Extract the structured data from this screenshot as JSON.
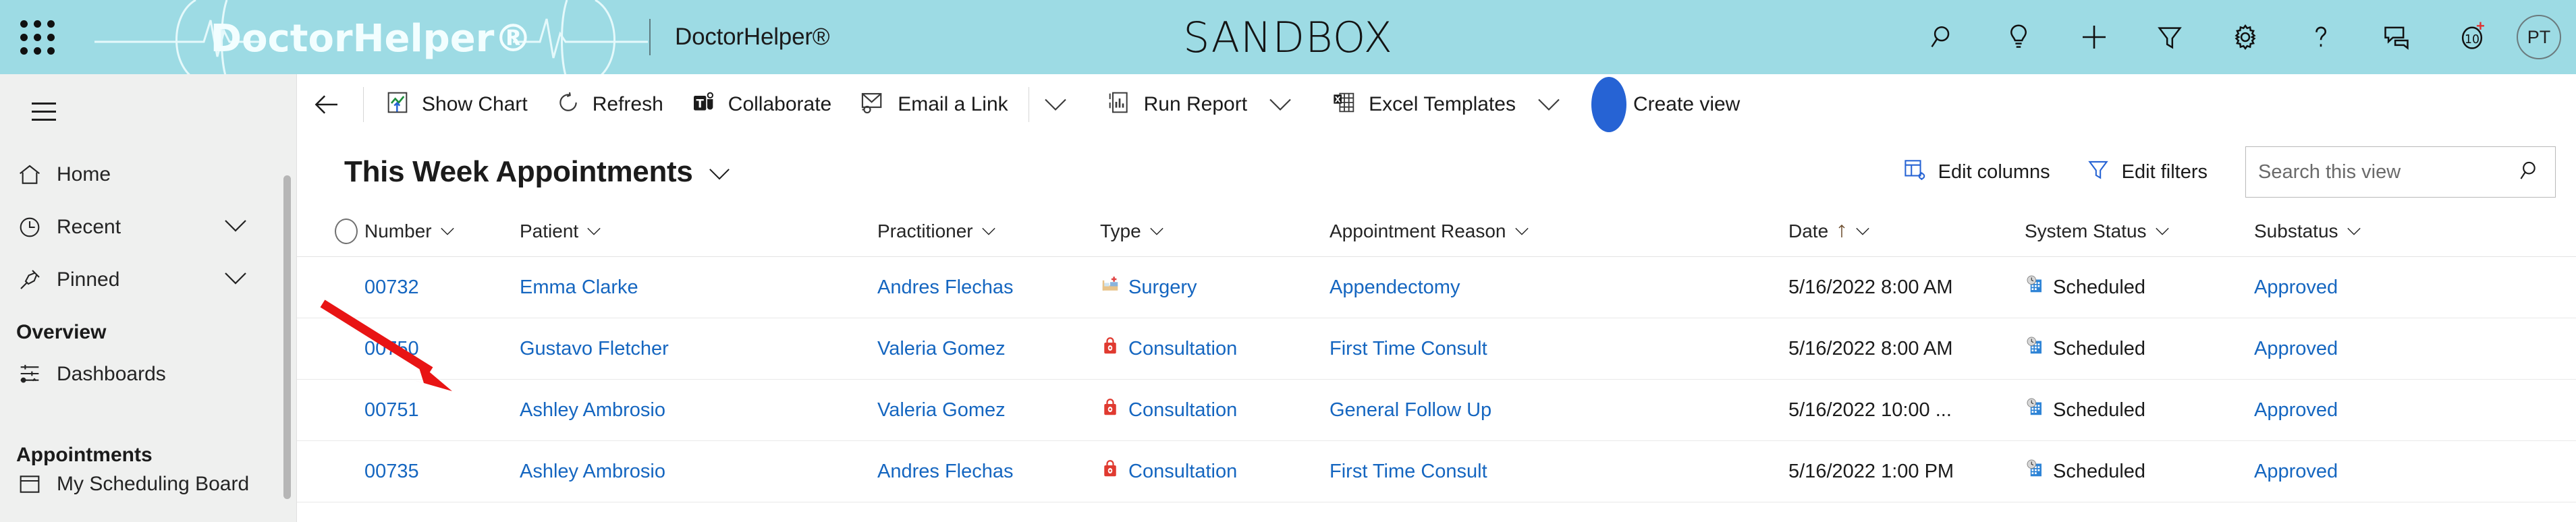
{
  "topbar": {
    "waffle_label": "app-launcher",
    "brand_logo_text": "DoctorHelper®",
    "app_name": "DoctorHelper®",
    "environment_title": "SANDBOX",
    "accent_color": "#9ddbe4",
    "actions": [
      {
        "name": "search-icon",
        "label": "Search"
      },
      {
        "name": "lightbulb-icon",
        "label": "Ideas"
      },
      {
        "name": "plus-icon",
        "label": "New"
      },
      {
        "name": "filter-icon",
        "label": "Filter"
      },
      {
        "name": "gear-icon",
        "label": "Settings"
      },
      {
        "name": "help-icon",
        "label": "Help"
      },
      {
        "name": "feedback-icon",
        "label": "Feedback"
      },
      {
        "name": "assistant-icon",
        "label": "10+"
      }
    ],
    "notification_badge": "10",
    "notification_plus": "+",
    "avatar_initials": "PT"
  },
  "sidebar": {
    "hamburger_label": "Site Map",
    "items": [
      {
        "name": "home",
        "label": "Home",
        "icon": "home-icon",
        "expandable": false
      },
      {
        "name": "recent",
        "label": "Recent",
        "icon": "clock-icon",
        "expandable": true
      },
      {
        "name": "pinned",
        "label": "Pinned",
        "icon": "pin-icon",
        "expandable": true
      }
    ],
    "groups": [
      {
        "label": "Overview",
        "items": [
          {
            "name": "dashboards",
            "label": "Dashboards",
            "icon": "dashboard-icon"
          }
        ]
      },
      {
        "label": "Appointments",
        "items": [
          {
            "name": "my-scheduling-board",
            "label": "My Scheduling Board",
            "icon": "board-icon"
          }
        ]
      }
    ]
  },
  "commandbar": {
    "back_label": "Back",
    "items": [
      {
        "name": "show-chart",
        "label": "Show Chart",
        "icon": "chart-icon",
        "chevron": false
      },
      {
        "name": "refresh",
        "label": "Refresh",
        "icon": "refresh-icon",
        "chevron": false
      },
      {
        "name": "collaborate",
        "label": "Collaborate",
        "icon": "teams-icon",
        "chevron": false
      },
      {
        "name": "email-a-link",
        "label": "Email a Link",
        "icon": "email-link-icon",
        "chevron": true
      },
      {
        "name": "run-report",
        "label": "Run Report",
        "icon": "report-icon",
        "chevron": true
      },
      {
        "name": "excel-templates",
        "label": "Excel Templates",
        "icon": "excel-icon",
        "chevron": true
      },
      {
        "name": "create-view",
        "label": "Create view",
        "icon": "",
        "chevron": false
      }
    ]
  },
  "view": {
    "title": "This Week Appointments",
    "edit_columns_label": "Edit columns",
    "edit_filters_label": "Edit filters",
    "search_placeholder": "Search this view",
    "search_value": ""
  },
  "table": {
    "columns": [
      {
        "key": "number",
        "label": "Number",
        "sort": ""
      },
      {
        "key": "patient",
        "label": "Patient",
        "sort": ""
      },
      {
        "key": "practitioner",
        "label": "Practitioner",
        "sort": ""
      },
      {
        "key": "type",
        "label": "Type",
        "sort": ""
      },
      {
        "key": "reason",
        "label": "Appointment Reason",
        "sort": ""
      },
      {
        "key": "date",
        "label": "Date",
        "sort": "asc"
      },
      {
        "key": "system_status",
        "label": "System Status",
        "sort": ""
      },
      {
        "key": "substatus",
        "label": "Substatus",
        "sort": ""
      }
    ],
    "rows": [
      {
        "number": "00732",
        "patient": "Emma Clarke",
        "practitioner": "Andres Flechas",
        "type": "Surgery",
        "type_icon": "hospital-bed-icon",
        "reason": "Appendectomy",
        "date": "5/16/2022 8:00 AM",
        "system_status": "Scheduled",
        "status_icon": "calendar-clock-icon",
        "substatus": "Approved"
      },
      {
        "number": "00750",
        "patient": "Gustavo Fletcher",
        "practitioner": "Valeria Gomez",
        "type": "Consultation",
        "type_icon": "consultation-icon",
        "reason": "First Time Consult",
        "date": "5/16/2022 8:00 AM",
        "system_status": "Scheduled",
        "status_icon": "calendar-clock-icon",
        "substatus": "Approved"
      },
      {
        "number": "00751",
        "patient": "Ashley Ambrosio",
        "practitioner": "Valeria Gomez",
        "type": "Consultation",
        "type_icon": "consultation-icon",
        "reason": "General Follow Up",
        "date": "5/16/2022 10:00 ...",
        "system_status": "Scheduled",
        "status_icon": "calendar-clock-icon",
        "substatus": "Approved"
      },
      {
        "number": "00735",
        "patient": "Ashley Ambrosio",
        "practitioner": "Andres Flechas",
        "type": "Consultation",
        "type_icon": "consultation-icon",
        "reason": "First Time Consult",
        "date": "5/16/2022 1:00 PM",
        "system_status": "Scheduled",
        "status_icon": "calendar-clock-icon",
        "substatus": "Approved"
      }
    ]
  },
  "annotations": {
    "arrow_color": "#e81414",
    "cursor_color": "#2663d4"
  }
}
